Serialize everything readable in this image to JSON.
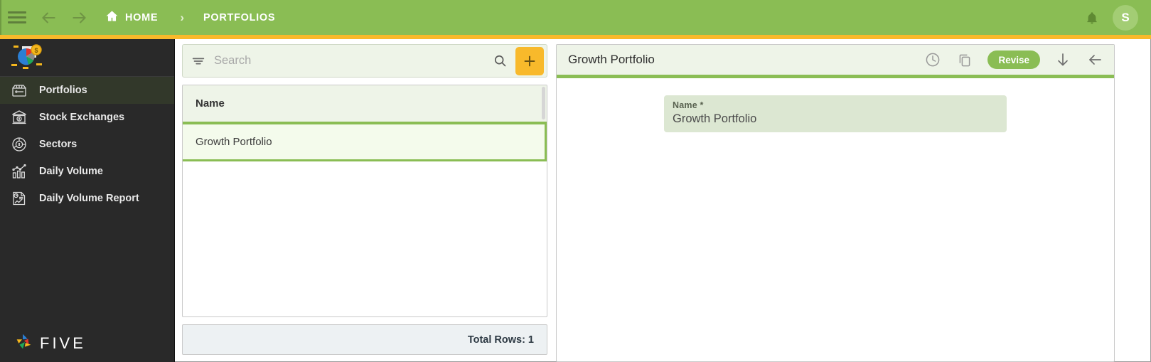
{
  "topbar": {
    "menu_icon": "hamburger-icon",
    "back_icon": "arrow-left-icon",
    "forward_icon": "arrow-right-icon",
    "home_icon": "home-icon",
    "home_label": "HOME",
    "breadcrumb_separator": "›",
    "current_label": "PORTFOLIOS",
    "notifications_icon": "bell-icon",
    "avatar_initial": "S",
    "bg_color": "#8ABD54",
    "accent_color": "#F8B92B"
  },
  "sidebar": {
    "logo_name": "app-logo-pie-chart",
    "items": [
      {
        "label": "Portfolios",
        "icon": "portfolio-drawer-icon",
        "active": true
      },
      {
        "label": "Stock Exchanges",
        "icon": "bank-icon",
        "active": false
      },
      {
        "label": "Sectors",
        "icon": "pie-chart-dollar-icon",
        "active": false
      },
      {
        "label": "Daily Volume",
        "icon": "bar-chart-icon",
        "active": false
      },
      {
        "label": "Daily Volume Report",
        "icon": "report-document-icon",
        "active": false
      }
    ],
    "footer_brand": "FIVE",
    "bg_color": "#292929"
  },
  "list_panel": {
    "search": {
      "placeholder": "Search",
      "value": "",
      "filter_icon": "filter-icon",
      "search_icon": "search-icon"
    },
    "add_button_label": "+",
    "columns": [
      "Name"
    ],
    "rows": [
      {
        "name": "Growth Portfolio",
        "selected": true
      }
    ],
    "footer_text": "Total Rows: 1"
  },
  "detail_panel": {
    "title": "Growth Portfolio",
    "actions": [
      {
        "name": "history-clock-icon",
        "label": ""
      },
      {
        "name": "copy-icon",
        "label": ""
      }
    ],
    "revise_label": "Revise",
    "download_icon": "arrow-down-icon",
    "back_icon": "arrow-left-icon",
    "fields": [
      {
        "label": "Name *",
        "value": "Growth Portfolio"
      }
    ]
  }
}
